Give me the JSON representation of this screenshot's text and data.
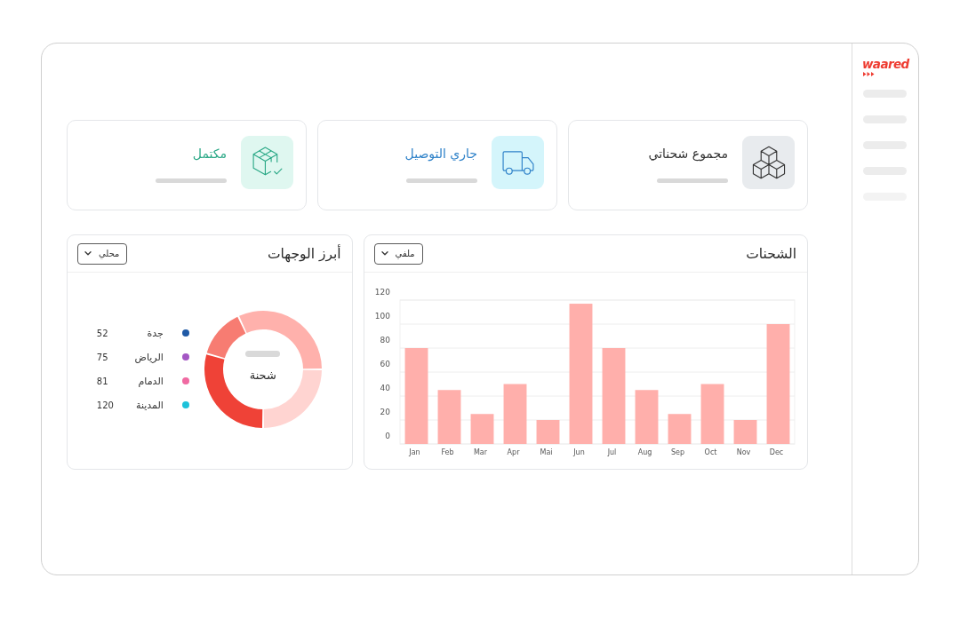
{
  "sidebar": {
    "logo": "waared"
  },
  "stat_cards": [
    {
      "title": "مجموع شحناتي",
      "color": "#333333"
    },
    {
      "title": "جاري التوصيل",
      "color": "#2f82c9"
    },
    {
      "title": "مكتمل",
      "color": "#2aa886"
    }
  ],
  "shipments_panel": {
    "title": "الشحنات",
    "filter": "ملفي",
    "chart_data": {
      "type": "bar",
      "categories": [
        "Jan",
        "Feb",
        "Mar",
        "Apr",
        "Mai",
        "Jun",
        "Jul",
        "Aug",
        "Sep",
        "Oct",
        "Nov",
        "Dec"
      ],
      "values": [
        80,
        45,
        25,
        50,
        20,
        117,
        80,
        45,
        25,
        50,
        20,
        100
      ],
      "color": "#ffafab",
      "ylim": [
        0,
        120
      ],
      "yticks": [
        0,
        20,
        40,
        60,
        80,
        100,
        120
      ],
      "grid": true
    }
  },
  "destinations_panel": {
    "title": "أبرز الوجهات",
    "filter": "محلي",
    "center_label": "شحنة",
    "legend": [
      {
        "name": "جدة",
        "value": "52",
        "color": "#1f5aa6"
      },
      {
        "name": "الرياض",
        "value": "75",
        "color": "#a457c4"
      },
      {
        "name": "الدمام",
        "value": "81",
        "color": "#f06aa2"
      },
      {
        "name": "المدينة",
        "value": "120",
        "color": "#1ec2da"
      }
    ]
  }
}
